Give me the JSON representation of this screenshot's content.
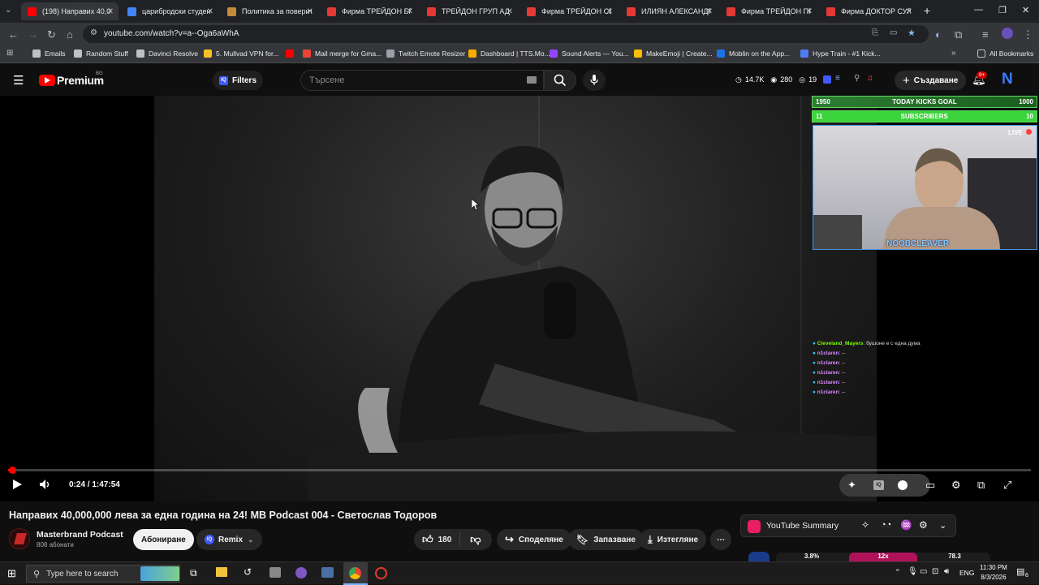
{
  "browser": {
    "tabs": [
      {
        "title": "(198) Направих 40,0",
        "color": "#ff0000",
        "active": true
      },
      {
        "title": "царибродски студен",
        "color": "#4285f4"
      },
      {
        "title": "Политика за поверит",
        "color": "#c58a3a"
      },
      {
        "title": "Фирма ТРЕЙДОН БГ",
        "color": "#e53935"
      },
      {
        "title": "ТРЕЙДОН ГРУП АД",
        "color": "#e53935"
      },
      {
        "title": "Фирма ТРЕЙДОН СЕ",
        "color": "#e53935"
      },
      {
        "title": "ИЛИЯН АЛЕКСАНДР",
        "color": "#e53935"
      },
      {
        "title": "Фирма ТРЕЙДОН ПР",
        "color": "#e53935"
      },
      {
        "title": "Фирма ДОКТОР СУЛ",
        "color": "#e53935"
      }
    ],
    "new_tab": "+",
    "url": "youtube.com/watch?v=a--Oga6aWhA",
    "bookmarks": [
      {
        "label": "Emails",
        "color": "#bdc1c6"
      },
      {
        "label": "Random Stuff",
        "color": "#bdc1c6"
      },
      {
        "label": "Davinci Resolve",
        "color": "#bdc1c6"
      },
      {
        "label": "5. Mullvad VPN for...",
        "color": "#f6c026"
      },
      {
        "label": "",
        "color": "#ff0000"
      },
      {
        "label": "Mail merge for Gma...",
        "color": "#ea4335"
      },
      {
        "label": "Twitch Emote Resizer",
        "color": "#9aa0a6"
      },
      {
        "label": "Dashboard | TTS.Mo...",
        "color": "#f9ab00"
      },
      {
        "label": "Sound Alerts — You...",
        "color": "#9146ff"
      },
      {
        "label": "MakeEmoji | Create...",
        "color": "#fbbc04"
      },
      {
        "label": "Moblin on the App...",
        "color": "#1a73e8"
      },
      {
        "label": "Hype Train - #1 Kick...",
        "color": "#4f7df3"
      }
    ],
    "all_bookmarks": "All Bookmarks"
  },
  "youtube": {
    "logo": "Premium",
    "region": "BG",
    "filters_label": "Filters",
    "search_placeholder": "Търсене",
    "stats": {
      "views": "14.7K",
      "likes": "280",
      "watching": "19"
    },
    "create_label": "Създаване",
    "notifications": "9+",
    "avatar_letter": "N"
  },
  "stream_overlay": {
    "kicks_goal": {
      "left": "1950",
      "label": "TODAY KICKS GOAL",
      "right": "1000"
    },
    "subscribers": {
      "left": "11",
      "label": "SUBSCRIBERS",
      "right": "10"
    },
    "live_label": "LIVE",
    "streamer_name": "NOOBCLEAVER",
    "chat": [
      {
        "user": "Cleveland_Mayers",
        "text": ": бушоне е с една дума"
      },
      {
        "user": "n1claren",
        "text": ": --"
      },
      {
        "user": "n1claren",
        "text": ": --"
      },
      {
        "user": "n1claren",
        "text": ": --"
      },
      {
        "user": "n1claren",
        "text": ": --"
      },
      {
        "user": "n1claren",
        "text": ": --"
      }
    ]
  },
  "player": {
    "time": "0:24 / 1:47:54",
    "progress": 0.004
  },
  "video": {
    "title": "Направих 40,000,000 лева за една година на 24! MB Podcast 004 - Светослав Тодоров",
    "channel": "Masterbrand Podcast",
    "subscribers": "808 абонати",
    "subscribe_label": "Абониране",
    "remix_label": "Remix",
    "likes": "180",
    "share_label": "Споделяне",
    "save_label": "Запазване",
    "download_label": "Изтегляне"
  },
  "summary_panel": {
    "title": "YouTube Summary",
    "values": [
      "3.8%",
      "12x",
      "78.3"
    ]
  },
  "taskbar": {
    "search_placeholder": "Type here to search",
    "lang": "ENG",
    "time": "11:30 PM",
    "date": "8/3/2026",
    "notif_count": "6"
  }
}
